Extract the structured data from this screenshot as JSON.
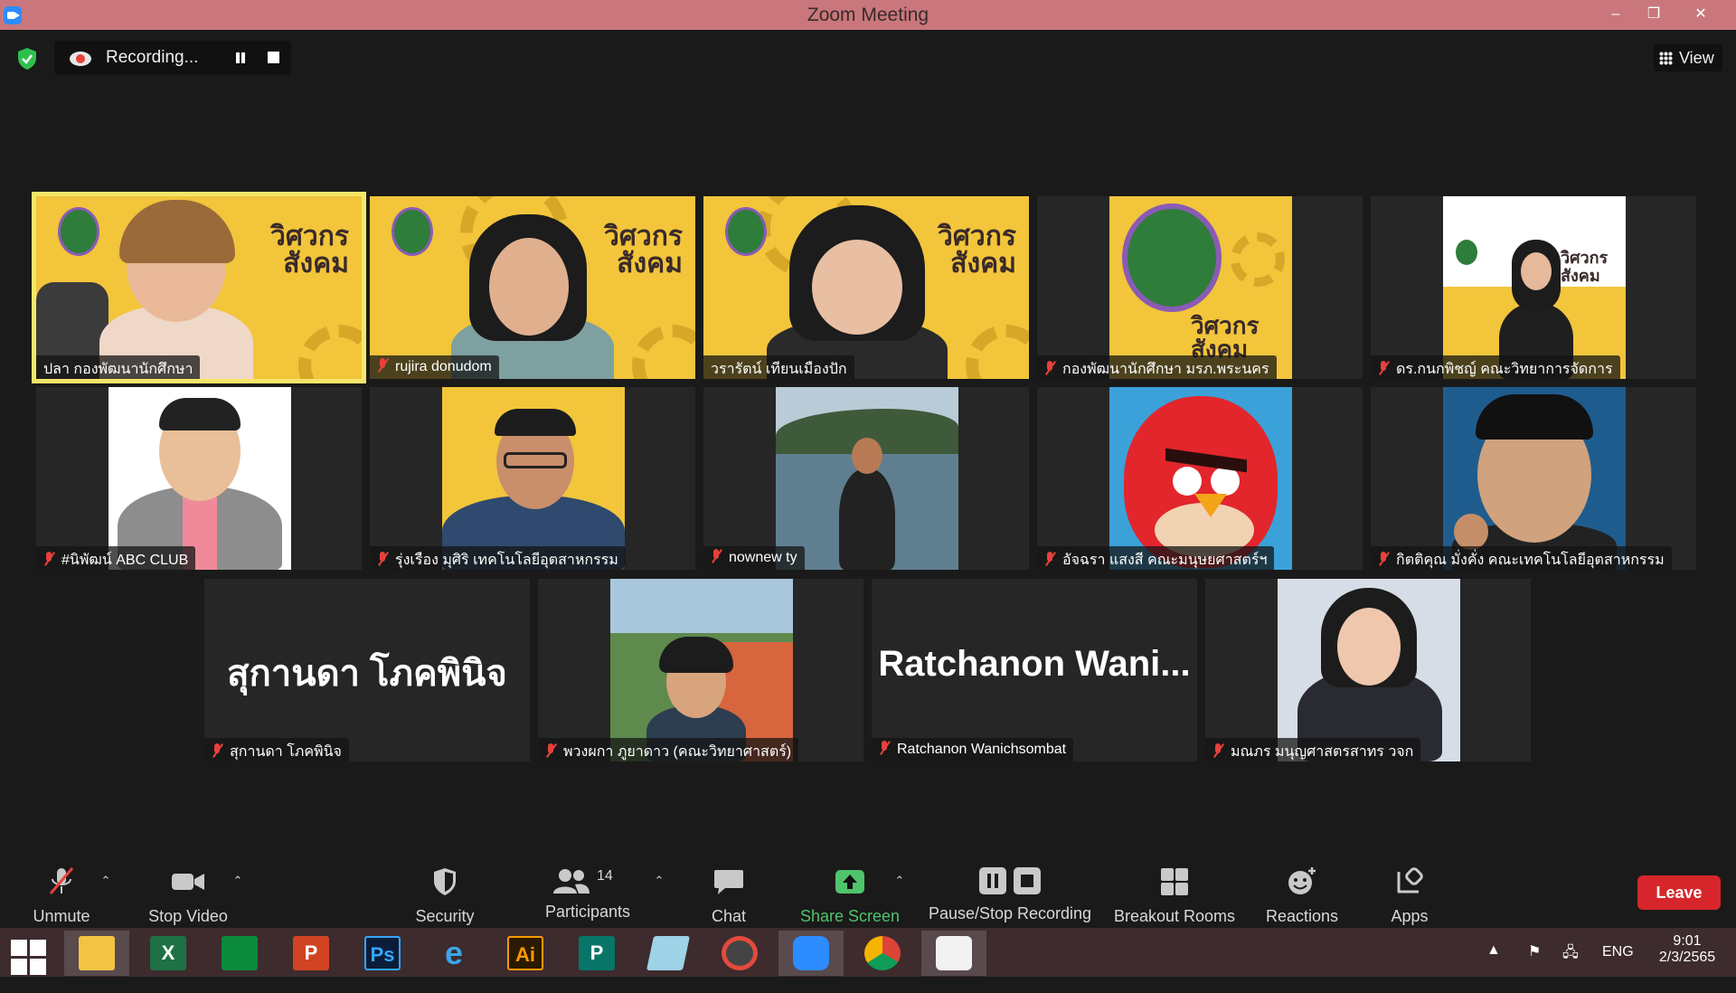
{
  "window": {
    "title": "Zoom Meeting",
    "minimize": "–",
    "restore": "❐",
    "close": "✕"
  },
  "topbar": {
    "recording_label": "Recording...",
    "view_label": "View"
  },
  "tiles": [
    {
      "name": "ปลา กองพัฒนานักศึกษา",
      "muted": false
    },
    {
      "name": "rujira donudom",
      "muted": true
    },
    {
      "name": "วรารัตน์ เทียนเมืองปัก",
      "muted": false
    },
    {
      "name": "กองพัฒนานักศึกษา มรภ.พระนคร",
      "muted": true
    },
    {
      "name": "ดร.กนกพิชญ์ คณะวิทยาการจัดการ",
      "muted": true
    },
    {
      "name": "#นิพัฒน์ ABC CLUB",
      "muted": true
    },
    {
      "name": "รุ่งเรือง มุศิริ เทคโนโลยีอุตสาหกรรม",
      "muted": true
    },
    {
      "name": "nownew ty",
      "muted": true
    },
    {
      "name": "อัจฉรา แสงสี คณะมนุษยศาสตร์ฯ",
      "muted": true
    },
    {
      "name": "กิตติคุณ มั่งคั่ง คณะเทคโนโลยีอุตสาหกรรม",
      "muted": true
    },
    {
      "name": "สุกานดา โภคพินิจ",
      "muted": true,
      "display_name": "สุกานดา โภคพินิจ"
    },
    {
      "name": "พวงผกา ภูยาดาว (คณะวิทยาศาสตร์)",
      "muted": true
    },
    {
      "name": "Ratchanon Wanichsombat",
      "muted": true,
      "display_name": "Ratchanon  Wani..."
    },
    {
      "name": "มณภร มนุญศาสตรสาทร วจก",
      "muted": true
    }
  ],
  "video_branding": {
    "line1": "วิศวกร",
    "line2": "สังคม"
  },
  "toolbar": {
    "unmute": "Unmute",
    "stop_video": "Stop Video",
    "security": "Security",
    "participants": "Participants",
    "participants_count": "14",
    "chat": "Chat",
    "share_screen": "Share Screen",
    "pause_stop_recording": "Pause/Stop Recording",
    "breakout_rooms": "Breakout Rooms",
    "reactions": "Reactions",
    "apps": "Apps",
    "leave": "Leave"
  },
  "taskbar": {
    "apps": [
      {
        "name": "file-explorer",
        "glyph": ""
      },
      {
        "name": "excel",
        "glyph": "X"
      },
      {
        "name": "store",
        "glyph": ""
      },
      {
        "name": "powerpoint",
        "glyph": "P"
      },
      {
        "name": "photoshop",
        "glyph": "Ps"
      },
      {
        "name": "internet-explorer",
        "glyph": "e"
      },
      {
        "name": "illustrator",
        "glyph": "Ai"
      },
      {
        "name": "publisher",
        "glyph": "P"
      },
      {
        "name": "notes",
        "glyph": ""
      },
      {
        "name": "photoscape",
        "glyph": ""
      },
      {
        "name": "zoom",
        "glyph": ""
      },
      {
        "name": "chrome",
        "glyph": ""
      },
      {
        "name": "paint",
        "glyph": ""
      }
    ],
    "language": "ENG",
    "time": "9:01",
    "date": "2/3/2565"
  },
  "colors": {
    "titlebar": "#c9777c",
    "active_speaker": "#f5e66a",
    "share_green": "#4fc46b",
    "leave_red": "#d6262b",
    "muted_red": "#e8413c"
  }
}
